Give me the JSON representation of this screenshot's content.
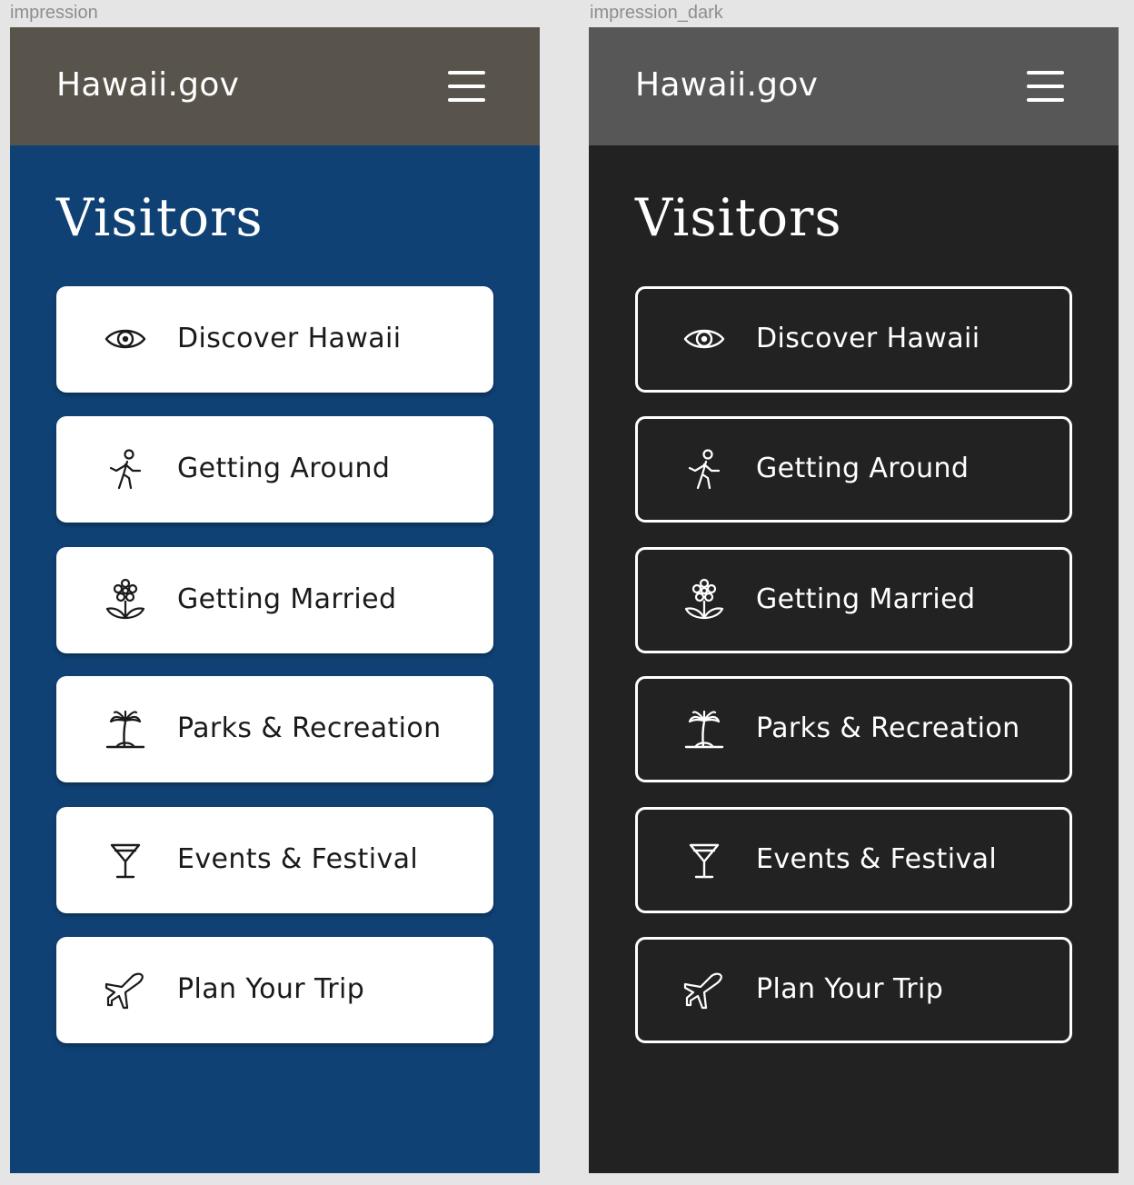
{
  "frames": [
    {
      "id": "light",
      "frame_label": "impression",
      "header": {
        "site_title": "Hawaii.gov",
        "menu_icon": "hamburger-menu-icon"
      },
      "page_title": "Visitors",
      "colors": {
        "page_bg": "#0f4174",
        "header_bg": "#58534b",
        "card_bg": "#ffffff",
        "card_text": "#1a1a1a"
      },
      "cards": [
        {
          "icon": "eye-icon",
          "label": "Discover Hawaii"
        },
        {
          "icon": "walking-person-icon",
          "label": "Getting Around"
        },
        {
          "icon": "flower-icon",
          "label": "Getting Married"
        },
        {
          "icon": "palm-tree-icon",
          "label": "Parks & Recreation"
        },
        {
          "icon": "cocktail-glass-icon",
          "label": "Events & Festival"
        },
        {
          "icon": "airplane-icon",
          "label": "Plan Your Trip"
        }
      ]
    },
    {
      "id": "dark",
      "frame_label": "impression_dark",
      "header": {
        "site_title": "Hawaii.gov",
        "menu_icon": "hamburger-menu-icon"
      },
      "page_title": "Visitors",
      "colors": {
        "page_bg": "#222222",
        "header_bg": "#575757",
        "card_bg": "#222222",
        "card_border": "#ffffff",
        "card_text": "#ffffff"
      },
      "cards": [
        {
          "icon": "eye-icon",
          "label": "Discover Hawaii"
        },
        {
          "icon": "walking-person-icon",
          "label": "Getting Around"
        },
        {
          "icon": "flower-icon",
          "label": "Getting Married"
        },
        {
          "icon": "palm-tree-icon",
          "label": "Parks & Recreation"
        },
        {
          "icon": "cocktail-glass-icon",
          "label": "Events & Festival"
        },
        {
          "icon": "airplane-icon",
          "label": "Plan Your Trip"
        }
      ]
    }
  ]
}
